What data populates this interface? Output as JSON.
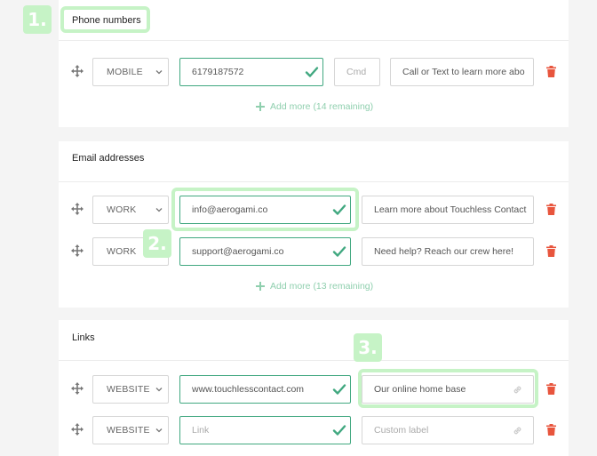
{
  "annotations": {
    "badge1": "1.",
    "badge2": "2.",
    "badge3": "3."
  },
  "phone_section": {
    "title": "Phone numbers",
    "row": {
      "type": "MOBILE",
      "value": "6179187572",
      "ext_placeholder": "Cmd",
      "label": "Call or Text to learn more abo"
    },
    "add_more": "Add more (14 remaining)"
  },
  "email_section": {
    "title": "Email addresses",
    "rows": [
      {
        "type": "WORK",
        "value": "info@aerogami.co",
        "label": "Learn more about Touchless Contact"
      },
      {
        "type": "WORK",
        "value": "support@aerogami.co",
        "label": "Need help? Reach our crew here!"
      }
    ],
    "add_more": "Add more (13 remaining)"
  },
  "links_section": {
    "title": "Links",
    "rows": [
      {
        "type": "WEBSITE",
        "value": "www.touchlesscontact.com",
        "label": "Our online home base"
      },
      {
        "type": "WEBSITE",
        "value_placeholder": "Link",
        "label_placeholder": "Custom label"
      }
    ]
  },
  "colors": {
    "accent_green": "#41a880",
    "highlight": "#c6f3c6",
    "delete_red": "#e8553d",
    "add_more_text": "#8fcfae"
  },
  "icons": {
    "drag": "move-icon",
    "dropdown": "chevron-down-icon",
    "valid": "check-icon",
    "delete": "trash-icon",
    "add": "plus-icon",
    "link": "link-icon"
  }
}
